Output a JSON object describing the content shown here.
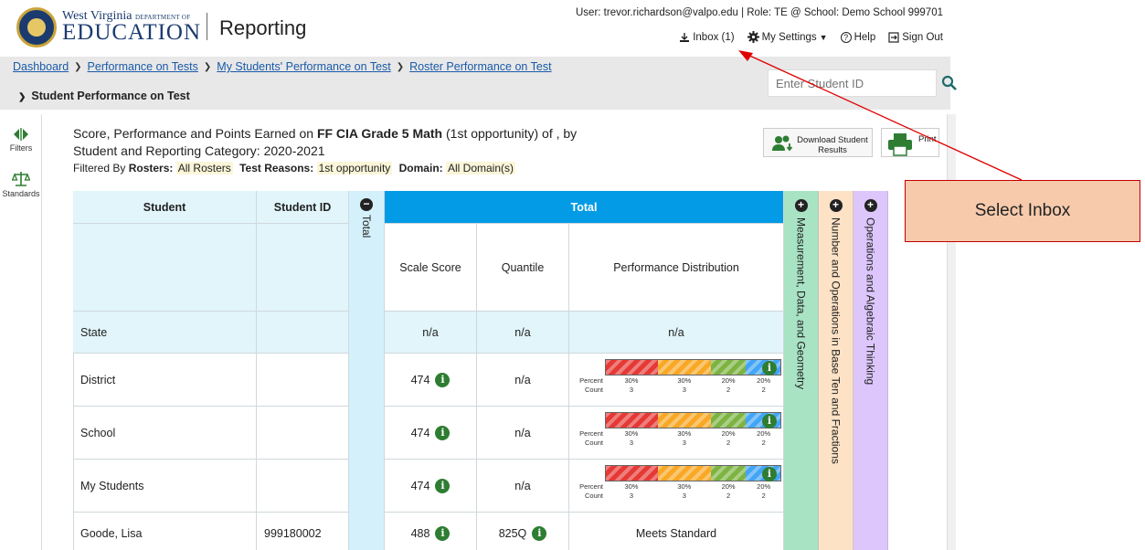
{
  "header": {
    "org_line1": "West Virginia",
    "org_line1_small": "DEPARTMENT OF",
    "org_line2": "EDUCATION",
    "app_title": "Reporting",
    "user_line": "User: trevor.richardson@valpo.edu   |  Role: TE @ School: Demo School 999701",
    "inbox": "Inbox (1)",
    "settings": "My Settings",
    "help": "Help",
    "signout": "Sign Out"
  },
  "breadcrumb": {
    "items": [
      "Dashboard",
      "Performance on Tests",
      "My Students' Performance on Test",
      "Roster Performance on Test"
    ],
    "current": "Student Performance on Test"
  },
  "search": {
    "placeholder": "Enter Student ID"
  },
  "rail": {
    "filters": "Filters",
    "standards": "Standards"
  },
  "report": {
    "title_prefix": "Score, Performance and Points Earned on ",
    "title_test": "FF CIA Grade 5 Math",
    "title_suffix": " (1st opportunity) of , by",
    "title_line2": "Student and Reporting Category: 2020-2021",
    "filtered_by": "Filtered By",
    "rosters_label": "Rosters:",
    "rosters_value": "All Rosters",
    "reasons_label": "Test Reasons:",
    "reasons_value": "1st opportunity",
    "domain_label": "Domain:",
    "domain_value": "All Domain(s)",
    "download_label": "Download Student Results",
    "print_label": "Print"
  },
  "table": {
    "col_student": "Student",
    "col_student_id": "Student ID",
    "col_total_vertical": "Total",
    "col_total_header": "Total",
    "col_scale": "Scale Score",
    "col_quantile": "Quantile",
    "col_perf": "Performance Distribution",
    "domains": [
      "Measurement, Data, and Geometry",
      "Number and Operations in Base Ten and Fractions",
      "Operations and Algebraic Thinking"
    ],
    "dist_percent_label": "Percent",
    "dist_count_label": "Count",
    "rows": [
      {
        "name": "State",
        "id": "",
        "scale": "n/a",
        "quantile": "n/a",
        "perf": "n/a"
      },
      {
        "name": "District",
        "id": "",
        "scale": "474",
        "quantile": "n/a",
        "perf": ""
      },
      {
        "name": "School",
        "id": "",
        "scale": "474",
        "quantile": "n/a",
        "perf": ""
      },
      {
        "name": "My Students",
        "id": "",
        "scale": "474",
        "quantile": "n/a",
        "perf": ""
      },
      {
        "name": "Goode, Lisa",
        "id": "999180002",
        "scale": "488",
        "quantile": "825Q",
        "perf": "Meets Standard"
      }
    ],
    "distribution": {
      "percents": [
        "30%",
        "30%",
        "20%",
        "20%"
      ],
      "counts": [
        "3",
        "3",
        "2",
        "2"
      ],
      "fractions": [
        0.3,
        0.3,
        0.2,
        0.2
      ],
      "colors": [
        "#e53935",
        "#f9a825",
        "#7cb342",
        "#42a5f5"
      ]
    }
  },
  "annotation": {
    "callout": "Select Inbox"
  }
}
